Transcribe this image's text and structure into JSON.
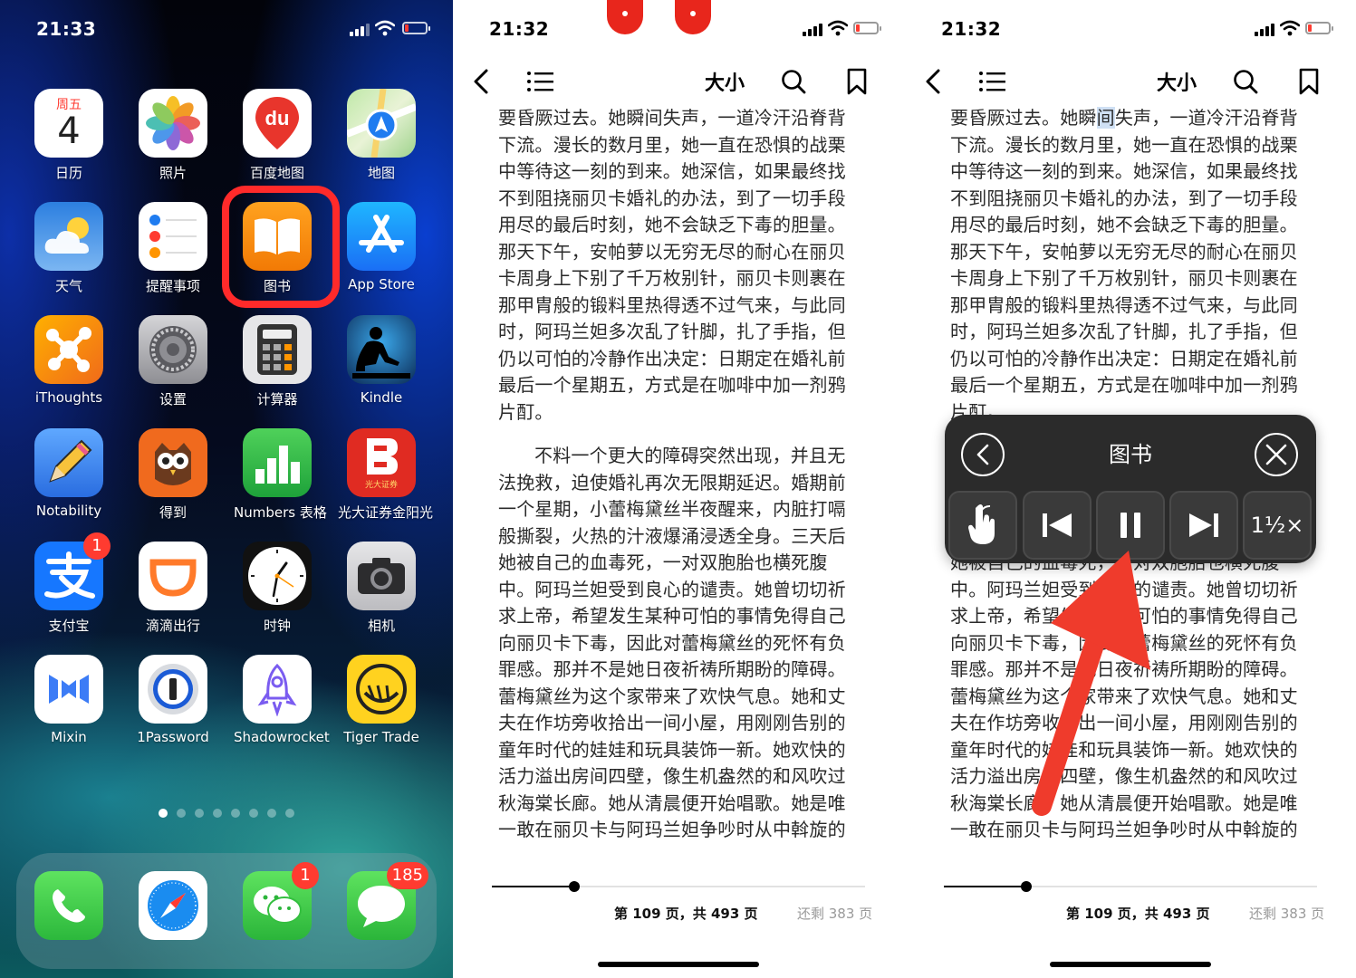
{
  "colors": {
    "highlight_red": "#ff2a2a",
    "badge_red": "#ff3b30",
    "arrow_red": "#ef3b2c",
    "controller_bg": "#2b2b2b"
  },
  "home": {
    "status": {
      "time": "21:33"
    },
    "calendar": {
      "weekday": "周五",
      "day": "4"
    },
    "apps": [
      {
        "label": "日历",
        "icon": "calendar-icon"
      },
      {
        "label": "照片",
        "icon": "photos-icon"
      },
      {
        "label": "百度地图",
        "icon": "baidu-map-icon",
        "glyph": "du"
      },
      {
        "label": "地图",
        "icon": "maps-icon"
      },
      {
        "label": "天气",
        "icon": "weather-icon"
      },
      {
        "label": "提醒事项",
        "icon": "reminders-icon"
      },
      {
        "label": "图书",
        "icon": "books-icon"
      },
      {
        "label": "App Store",
        "icon": "app-store-icon"
      },
      {
        "label": "iThoughts",
        "icon": "ithoughts-icon"
      },
      {
        "label": "设置",
        "icon": "settings-icon"
      },
      {
        "label": "计算器",
        "icon": "calculator-icon"
      },
      {
        "label": "Kindle",
        "icon": "kindle-icon"
      },
      {
        "label": "Notability",
        "icon": "notability-icon"
      },
      {
        "label": "得到",
        "icon": "dedao-icon"
      },
      {
        "label": "Numbers 表格",
        "icon": "numbers-icon"
      },
      {
        "label": "光大证券金阳光",
        "icon": "everbright-icon",
        "glyph": "光大证券"
      },
      {
        "label": "支付宝",
        "icon": "alipay-icon",
        "badge": "1"
      },
      {
        "label": "滴滴出行",
        "icon": "didi-icon"
      },
      {
        "label": "时钟",
        "icon": "clock-icon"
      },
      {
        "label": "相机",
        "icon": "camera-icon"
      },
      {
        "label": "Mixin",
        "icon": "mixin-icon"
      },
      {
        "label": "1Password",
        "icon": "1password-icon"
      },
      {
        "label": "Shadowrocket",
        "icon": "shadowrocket-icon"
      },
      {
        "label": "Tiger Trade",
        "icon": "tiger-trade-icon"
      }
    ],
    "page_dots": {
      "count": 8,
      "current": 1
    },
    "dock": [
      {
        "icon": "phone-icon"
      },
      {
        "icon": "safari-icon"
      },
      {
        "icon": "wechat-icon",
        "badge": "1"
      },
      {
        "icon": "messages-icon",
        "badge": "185"
      }
    ]
  },
  "reader": {
    "status_time": "21:32",
    "toolbar": {
      "size_label": "大小"
    },
    "paragraph1": "要昏厥过去。她瞬间失声，一道冷汗沿脊背下流。漫长的数月里，她一直在恐惧的战栗中等待这一刻的到来。她深信，如果最终找不到阻挠丽贝卡婚礼的办法，到了一切手段用尽的最后时刻，她不会缺乏下毒的胆量。那天下午，安帕萝以无穷无尽的耐心在丽贝卡周身上下别了千万枚别针，丽贝卡则裹在那甲胄般的锻料里热得透不过气来，与此同时，阿玛兰妲多次乱了针脚，扎了手指，但仍以可怕的冷静作出决定：日期定在婚礼前最后一个星期五，方式是在咖啡中加一剂鸦片酊。",
    "paragraph1_hl_before": "要昏厥过去。她瞬",
    "paragraph1_hl": "间",
    "paragraph1_hl_after": "失声，一道冷汗沿脊背下流。漫长的数月里，她一直在恐惧的战栗中等待这一刻的到来。她深信，如果最终找不到阻挠丽贝卡婚礼的办法，到了一切手段用尽的最后时刻，她不会缺乏下毒的胆量。那天下午，安帕萝以无穷无尽的耐心在丽贝卡周身上下别了千万枚别针，丽贝卡则裹在那甲胄般的锻料里热得透不过气来，与此同时，阿玛兰妲多次乱了针脚，扎了手指，但仍以可怕的冷静作出决定：日期定在婚礼前最后一个星期五，方式是在咖啡中加一剂鸦片酊。",
    "paragraph2": "不料一个更大的障碍突然出现，并且无法挽救，迫使婚礼再次无限期延迟。婚期前一个星期，小蕾梅黛丝半夜醒来，内脏打嗝般撕裂，火热的汁液爆涌浸透全身。三天后她被自己的血毒死，一对双胞胎也横死腹中。阿玛兰妲受到良心的谴责。她曾切切祈求上帝，希望发生某种可怕的事情免得自己向丽贝卡下毒，因此对蕾梅黛丝的死怀有负罪感。那并不是她日夜祈祷所期盼的障碍。蕾梅黛丝为这个家带来了欢快气息。她和丈夫在作坊旁收拾出一间小屋，用刚刚告别的童年时代的娃娃和玩具装饰一新。她欢快的活力溢出房间四壁，像生机盎然的和风吹过秋海棠长廊。她从清晨便开始唱歌。她是唯一敢在丽贝卡与阿玛兰妲争吵时从中斡旋的",
    "progress": 0.22,
    "page_info": "第 109 页，共 493 页",
    "remaining": "还剩 383 页"
  },
  "speak_controller": {
    "title": "图书",
    "rate_label": "1½×",
    "buttons": [
      "back-icon",
      "close-icon",
      "touch-icon",
      "previous-icon",
      "pause-icon",
      "next-icon"
    ]
  }
}
